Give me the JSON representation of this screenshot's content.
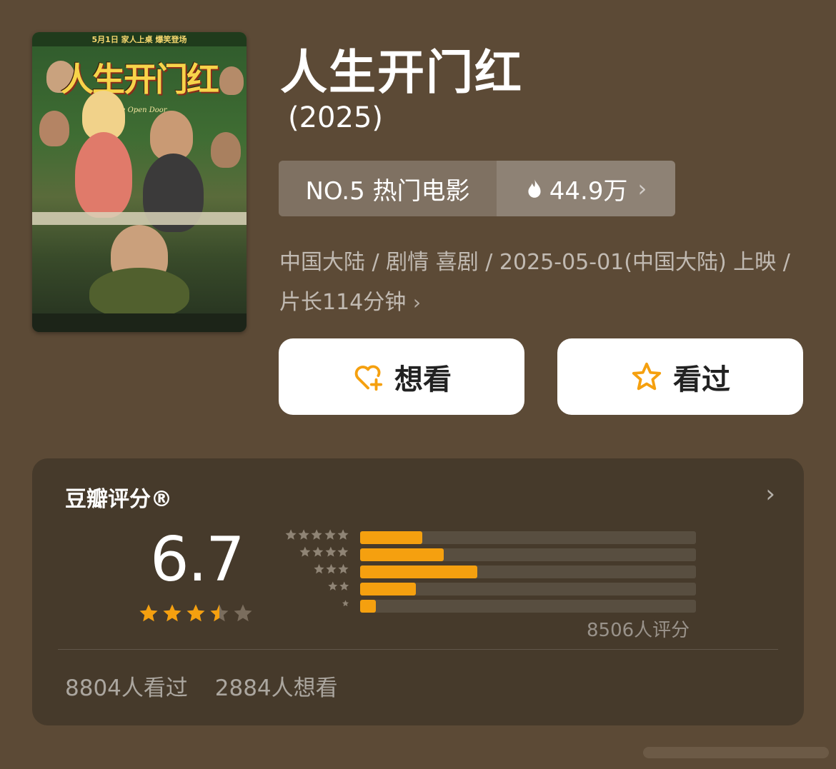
{
  "poster": {
    "top_text": "5月1日 家人上桌 爆笑登场",
    "title_text": "人生开门红",
    "subtitle_text": "The Open Door"
  },
  "movie": {
    "title": "人生开门红",
    "year": "(2025)"
  },
  "rank": {
    "label": "NO.5 热门电影",
    "heat": "44.9万"
  },
  "meta": {
    "line": "中国大陆 / 剧情 喜剧 / 2025-05-01(中国大陆) 上映 / 片长114分钟"
  },
  "actions": {
    "want_label": "想看",
    "seen_label": "看过"
  },
  "rating": {
    "label": "豆瓣评分®",
    "score": "6.7",
    "star_value": 3.5,
    "distribution_pct": [
      18.5,
      24.9,
      34.8,
      16.6,
      4.6
    ],
    "count_text": "8506人评分",
    "seen_text": "8804人看过",
    "want_text": "2884人想看"
  },
  "colors": {
    "background": "#5c4a36",
    "card": "#463a2b",
    "accent": "#f5a00f",
    "star_empty": "#7a6d5d"
  },
  "icons": {
    "heat": "flame-icon",
    "want": "heart-plus-icon",
    "seen": "star-outline-icon"
  }
}
